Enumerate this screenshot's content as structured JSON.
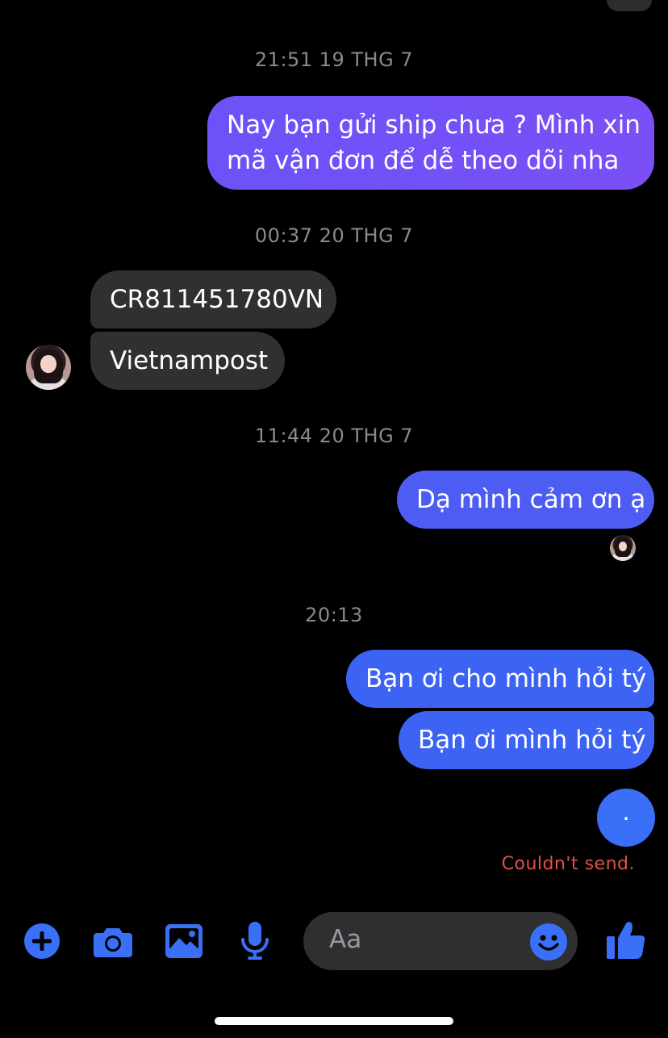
{
  "colors": {
    "background": "#000000",
    "incoming_bubble": "#303030",
    "accent": "#3a6ff7",
    "error": "#e0514a",
    "timestamp": "#8a8a8e"
  },
  "conversation": {
    "timestamp_1": "21:51 19 THG 7",
    "msg_out_1_line1": "Nay bạn gửi ship chưa ? Mình xin",
    "msg_out_1_line2": "mã vận đơn để dễ theo dõi nha",
    "timestamp_2": "00:37 20 THG 7",
    "msg_in_1": "CR811451780VN",
    "msg_in_2": "Vietnampost",
    "timestamp_3": "11:44 20 THG 7",
    "msg_out_2": "Dạ mình cảm ơn ạ",
    "timestamp_4": "20:13",
    "msg_out_3": "Bạn ơi cho mình hỏi tý",
    "msg_out_4": "Bạn ơi mình hỏi tý",
    "msg_out_5": ".",
    "send_error": "Couldn't send."
  },
  "composer": {
    "placeholder": "Aa",
    "icons": [
      "plus-icon",
      "camera-icon",
      "image-icon",
      "microphone-icon",
      "emoji-icon",
      "thumbs-up-icon"
    ]
  }
}
